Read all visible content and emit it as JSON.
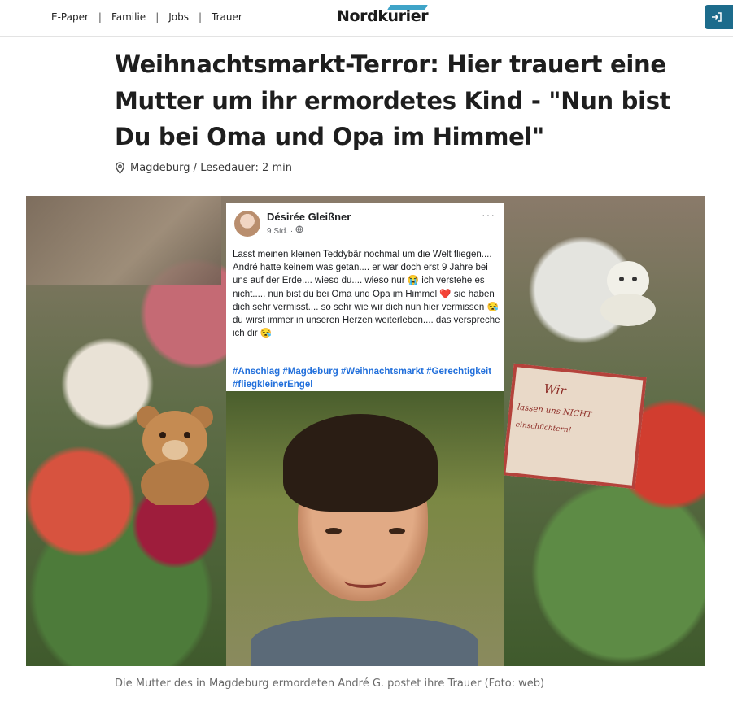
{
  "header": {
    "nav": [
      "E-Paper",
      "Familie",
      "Jobs",
      "Trauer"
    ],
    "logo": "Nordkurier"
  },
  "article": {
    "headline": "Weihnachtsmarkt-Terror: Hier trauert eine Mutter um ihr ermordetes Kind - \"Nun bist Du bei Oma und Opa im Himmel\"",
    "location_reading": "Magdeburg / Lesedauer: 2 min",
    "caption": "Die Mutter des in Magdeburg ermordeten André G. postet ihre Trauer (Foto: web)"
  },
  "post": {
    "author": "Désirée Gleißner",
    "time": "9 Std. · ",
    "more": "···",
    "text": "Lasst meinen kleinen Teddybär nochmal um die Welt fliegen.... André hatte keinem was getan.... er war doch erst 9 Jahre bei uns auf der Erde.... wieso du.... wieso nur 😭 ich verstehe es nicht..... nun bist du bei Oma und Opa im Himmel ❤️ sie haben dich sehr vermisst.... so sehr wie wir dich nun hier vermissen 😪 du wirst immer in unseren Herzen weiterleben.... das verspreche ich dir 😪",
    "hashtags": "#Anschlag #Magdeburg #Weihnachtsmarkt #Gerechtigkeit #fliegkleinerEngel"
  },
  "sign": {
    "line1": "Wir",
    "line2": "lassen uns NICHT",
    "line3": "einschüchtern!"
  },
  "colors": {
    "login_button": "#1d6c8c",
    "hashtag": "#216fdb",
    "logo_mark": "#3fa4c8"
  }
}
